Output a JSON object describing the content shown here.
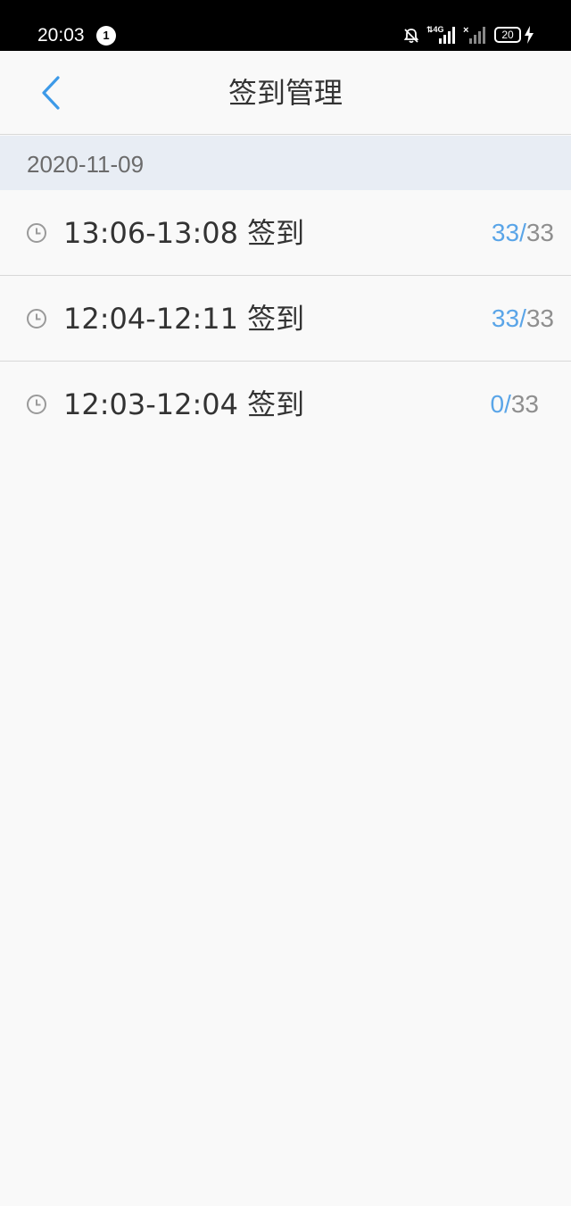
{
  "status_bar": {
    "time": "20:03",
    "notification_count": "1",
    "network": "4G",
    "battery": "20"
  },
  "header": {
    "title": "签到管理"
  },
  "date_group": {
    "date": "2020-11-09"
  },
  "sessions": [
    {
      "time_range": "13:06-13:08",
      "label": "签到",
      "present": "33",
      "separator": "/",
      "total": "33"
    },
    {
      "time_range": "12:04-12:11",
      "label": "签到",
      "present": "33",
      "separator": "/",
      "total": "33"
    },
    {
      "time_range": "12:03-12:04",
      "label": "签到",
      "present": "0",
      "separator": "/",
      "total": "33"
    }
  ],
  "colors": {
    "accent": "#3d9ae8",
    "present_count": "#5aa5e8",
    "total_count": "#8f8f8f",
    "date_bar": "#e8edf4"
  }
}
